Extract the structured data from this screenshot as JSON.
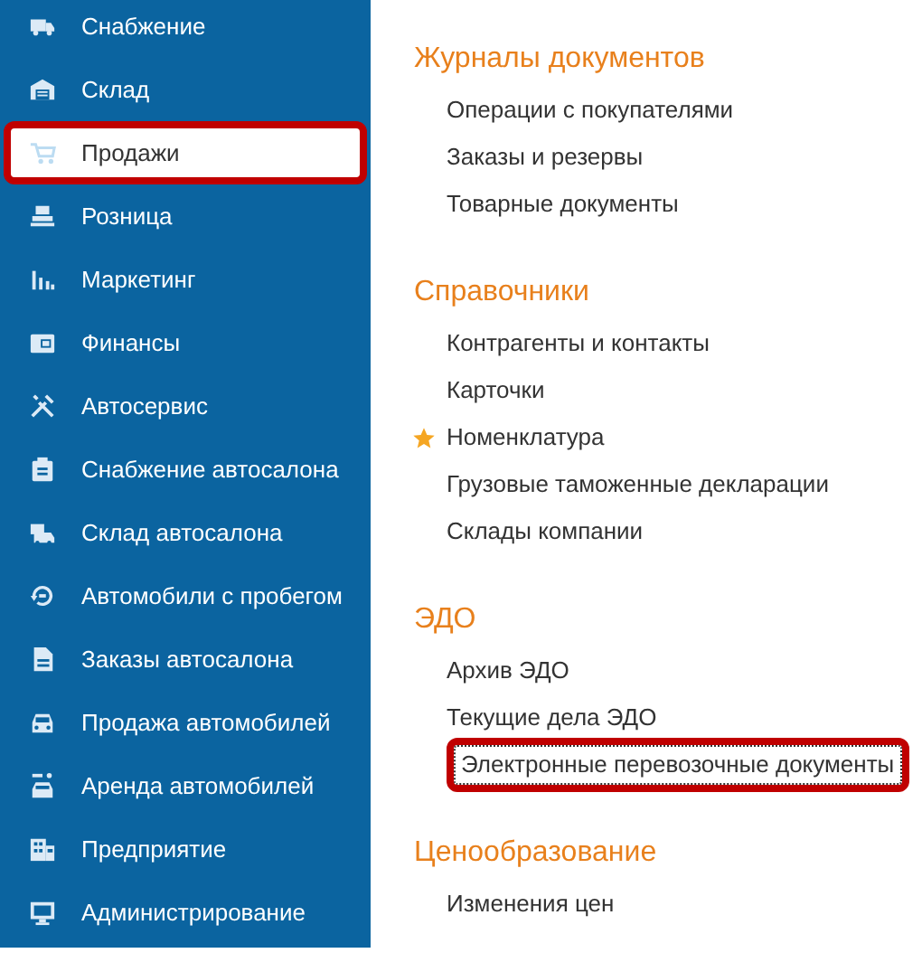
{
  "sidebar": {
    "items": [
      {
        "label": "Снабжение",
        "selected": false,
        "highlighted": false
      },
      {
        "label": "Склад",
        "selected": false,
        "highlighted": false
      },
      {
        "label": "Продажи",
        "selected": true,
        "highlighted": true
      },
      {
        "label": "Розница",
        "selected": false,
        "highlighted": false
      },
      {
        "label": "Маркетинг",
        "selected": false,
        "highlighted": false
      },
      {
        "label": "Финансы",
        "selected": false,
        "highlighted": false
      },
      {
        "label": "Автосервис",
        "selected": false,
        "highlighted": false
      },
      {
        "label": "Снабжение автосалона",
        "selected": false,
        "highlighted": false
      },
      {
        "label": "Склад автосалона",
        "selected": false,
        "highlighted": false
      },
      {
        "label": "Автомобили с пробегом",
        "selected": false,
        "highlighted": false
      },
      {
        "label": "Заказы автосалона",
        "selected": false,
        "highlighted": false
      },
      {
        "label": "Продажа автомобилей",
        "selected": false,
        "highlighted": false
      },
      {
        "label": "Аренда автомобилей",
        "selected": false,
        "highlighted": false
      },
      {
        "label": "Предприятие",
        "selected": false,
        "highlighted": false
      },
      {
        "label": "Администрирование",
        "selected": false,
        "highlighted": false
      }
    ]
  },
  "sections": [
    {
      "title": "Журналы документов",
      "items": [
        {
          "label": "Операции с покупателями",
          "starred": false,
          "highlighted": false
        },
        {
          "label": "Заказы и резервы",
          "starred": false,
          "highlighted": false
        },
        {
          "label": "Товарные документы",
          "starred": false,
          "highlighted": false
        }
      ]
    },
    {
      "title": "Справочники",
      "items": [
        {
          "label": "Контрагенты и контакты",
          "starred": false,
          "highlighted": false
        },
        {
          "label": "Карточки",
          "starred": false,
          "highlighted": false
        },
        {
          "label": "Номенклатура",
          "starred": true,
          "highlighted": false
        },
        {
          "label": "Грузовые таможенные декларации",
          "starred": false,
          "highlighted": false
        },
        {
          "label": "Склады компании",
          "starred": false,
          "highlighted": false
        }
      ]
    },
    {
      "title": "ЭДО",
      "items": [
        {
          "label": "Архив ЭДО",
          "starred": false,
          "highlighted": false
        },
        {
          "label": "Текущие дела ЭДО",
          "starred": false,
          "highlighted": false
        },
        {
          "label": "Электронные перевозочные документы",
          "starred": false,
          "highlighted": true
        }
      ]
    },
    {
      "title": "Ценообразование",
      "items": [
        {
          "label": "Изменения цен",
          "starred": false,
          "highlighted": false
        }
      ]
    }
  ]
}
